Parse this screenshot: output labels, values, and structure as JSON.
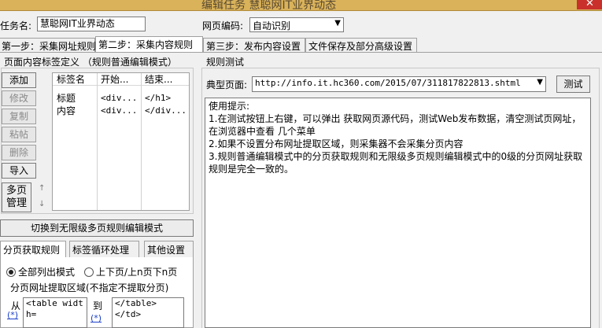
{
  "window": {
    "title": "编辑任务 慧聪网IT业界动态"
  },
  "task": {
    "name_label": "任务名:",
    "name_value": "慧聪网IT业界动态",
    "encoding_label": "网页编码:",
    "encoding_value": "自动识别"
  },
  "tabs": [
    {
      "label": "第一步：采集网址规则"
    },
    {
      "label": "第二步：采集内容规则"
    },
    {
      "label": "第三步：发布内容设置"
    },
    {
      "label": "文件保存及部分高级设置"
    }
  ],
  "tag_def": {
    "title": "页面内容标签定义 （规则普通编辑模式）",
    "buttons": {
      "add": "添加",
      "modify": "修改",
      "copy": "复制",
      "paste": "粘帖",
      "delete": "删除",
      "import": "导入",
      "multipage": "多页管理"
    },
    "columns": [
      "标签名",
      "开始...",
      "结束..."
    ],
    "rows": [
      [
        "标题",
        "<div...",
        "</h1>"
      ],
      [
        "内容",
        "<div...",
        "</div..."
      ]
    ]
  },
  "switch_button": "切换到无限级多页规则编辑模式",
  "sub_tabs": [
    "分页获取规则",
    "标签循环处理",
    "其他设置"
  ],
  "pagination": {
    "radio_all": "全部列出模式",
    "radio_prev": "上下页/上n页下n页",
    "region_label": "分页网址提取区域(不指定不提取分页)",
    "from_label": "从",
    "wildcard": "(*)",
    "to_label": "到",
    "from_value": "<table width=",
    "to_value": "</table></td>"
  },
  "rule_test": {
    "group_title": "规则测试",
    "page_label": "典型页面:",
    "page_url": "http://info.it.hc360.com/2015/07/311817822813.shtml",
    "test_button": "测试",
    "hint_lines": [
      "使用提示:",
      "1.在测试按钮上右键，可以弹出 获取网页源代码，测试Web发布数据，清空测试页网址，在浏览器中查看 几个菜单",
      "2.如果不设置分布网址提取区域，则采集器不会采集分页内容",
      "3.规则普通编辑模式中的分页获取规则和无限级多页规则编辑模式中的0级的分页网址获取规则是完全一致的。"
    ]
  }
}
